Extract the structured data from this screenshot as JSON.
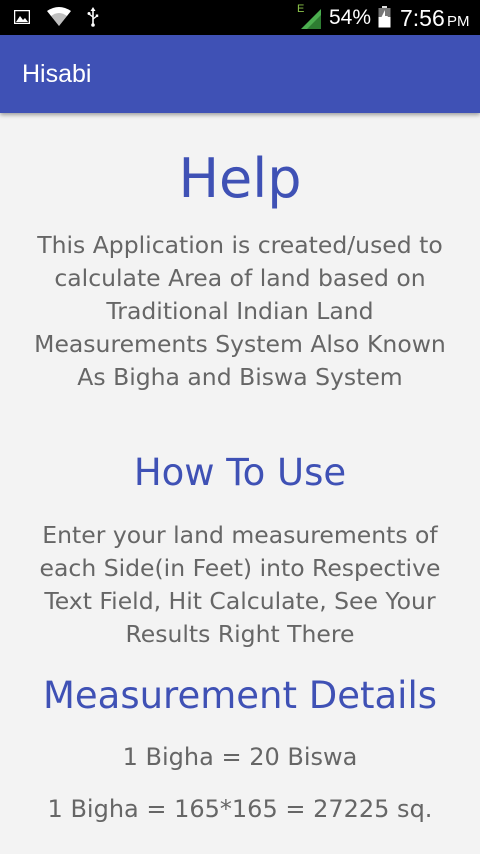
{
  "status_bar": {
    "icons": [
      "image-icon",
      "wifi-icon",
      "usb-icon",
      "signal-icon",
      "battery-icon"
    ],
    "signal_label": "E",
    "battery_percent": "54%",
    "time": "7:56",
    "ampm": "PM"
  },
  "app_bar": {
    "title": "Hisabi",
    "color": "#3f51b5"
  },
  "content": {
    "heading": "Help",
    "intro": "This Application is created/used to calculate Area of land based on Traditional Indian Land Measurements System Also Known As Bigha and Biswa System",
    "how_to_heading": "How To Use",
    "how_to_text": "Enter your land measurements of each Side(in Feet) into Respective Text Field, Hit Calculate, See Your Results Right There",
    "details_heading": "Measurement Details",
    "details": [
      "1 Bigha = 20 Biswa",
      "1 Bigha = 165*165 = 27225 sq."
    ]
  }
}
